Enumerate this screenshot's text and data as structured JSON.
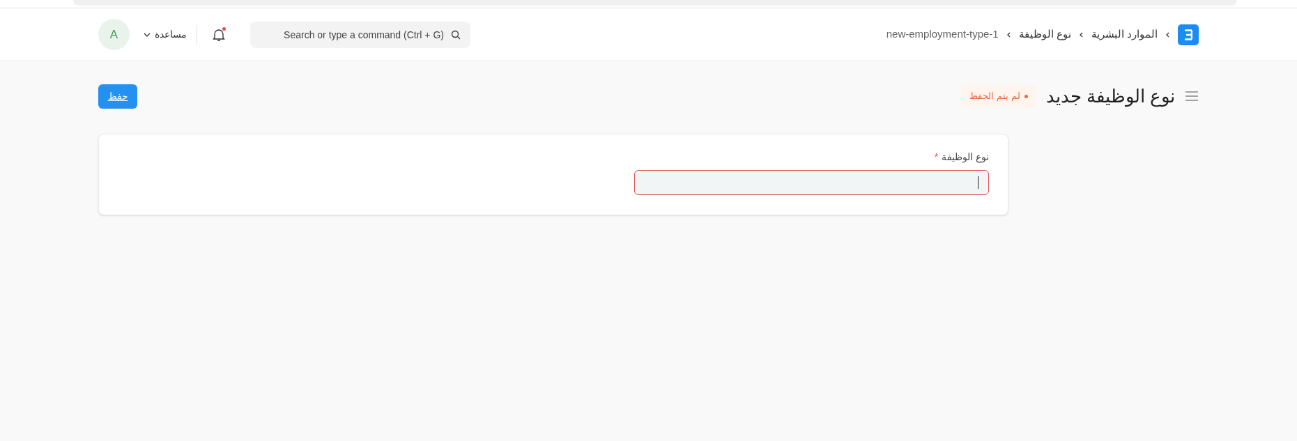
{
  "navbar": {
    "avatar": "A",
    "help": "مساعدة",
    "notifications": {
      "unread": true
    },
    "search": {
      "placeholder": "Search or type a command (Ctrl + G)"
    },
    "breadcrumbs": [
      "الموارد البشرية",
      "نوع الوظيفة",
      "new-employment-type-1"
    ]
  },
  "page": {
    "title": "نوع الوظيفة جديد",
    "status": "لم يتم الحفظ",
    "save_button": "حفظ"
  },
  "form": {
    "fields": [
      {
        "label": "نوع الوظيفة",
        "required": true,
        "required_mark": "*",
        "error": true,
        "focused": true
      }
    ]
  }
}
